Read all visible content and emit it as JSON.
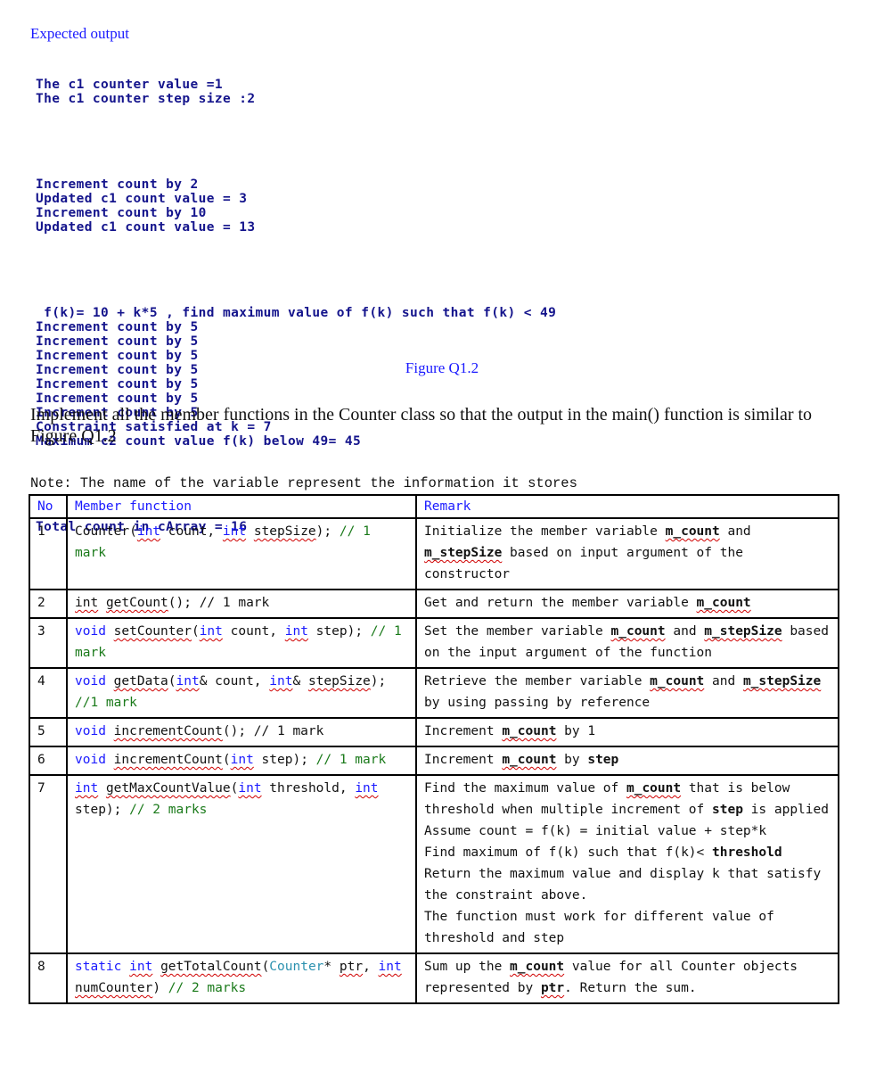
{
  "expected_label": "Expected output",
  "console": {
    "block1": [
      "The c1 counter value =1",
      "The c1 counter step size :2"
    ],
    "block2": [
      "Increment count by 2",
      "Updated c1 count value = 3",
      "Increment count by 10",
      "Updated c1 count value = 13"
    ],
    "block3": [
      " f(k)= 10 + k*5 , find maximum value of f(k) such that f(k) < 49",
      "Increment count by 5",
      "Increment count by 5",
      "Increment count by 5",
      "Increment count by 5",
      "Increment count by 5",
      "Increment count by 5",
      "Increment count by 5",
      "Constraint satisfied at k = 7",
      "Maximum c2 count value f(k) below 49= 45"
    ],
    "block4": [
      "Total count in cArray = 16"
    ]
  },
  "figure_caption": "Figure Q1.2",
  "instruction": "Implement all the member functions in the Counter class so that the output in the main() function is similar to Figure Q1.2",
  "note": "Note: The name of the variable represent the information it stores",
  "table": {
    "headers": {
      "no": "No",
      "function": "Member function",
      "remark": "Remark"
    },
    "rows": [
      {
        "no": "1",
        "function": [
          {
            "t": "Counter(",
            "c": ""
          },
          {
            "t": "int",
            "c": "kw sq"
          },
          {
            "t": " count, ",
            "c": ""
          },
          {
            "t": "int",
            "c": "kw sq"
          },
          {
            "t": " ",
            "c": ""
          },
          {
            "t": "stepSize",
            "c": "sq"
          },
          {
            "t": "); ",
            "c": ""
          },
          {
            "t": "// 1 mark",
            "c": "cm"
          }
        ],
        "remark": [
          [
            {
              "t": "Initialize the member variable ",
              "c": ""
            },
            {
              "t": "m_count",
              "c": "b sq"
            },
            {
              "t": " and ",
              "c": ""
            },
            {
              "t": "m_stepSize",
              "c": "b sq"
            },
            {
              "t": " based on input argument of the constructor",
              "c": ""
            }
          ]
        ]
      },
      {
        "no": "2",
        "function": [
          {
            "t": "int",
            "c": "sq"
          },
          {
            "t": " ",
            "c": ""
          },
          {
            "t": "getCount",
            "c": "sq"
          },
          {
            "t": "(); // 1 mark",
            "c": ""
          }
        ],
        "remark": [
          [
            {
              "t": "Get and return the member variable ",
              "c": ""
            },
            {
              "t": "m_count",
              "c": "b sq"
            }
          ]
        ]
      },
      {
        "no": "3",
        "function": [
          {
            "t": "void",
            "c": "kw"
          },
          {
            "t": " ",
            "c": ""
          },
          {
            "t": "setCounter",
            "c": "sq"
          },
          {
            "t": "(",
            "c": ""
          },
          {
            "t": "int",
            "c": "kw sq"
          },
          {
            "t": " count, ",
            "c": ""
          },
          {
            "t": "int",
            "c": "kw sq"
          },
          {
            "t": " step); ",
            "c": ""
          },
          {
            "t": "// 1 mark",
            "c": "cm"
          }
        ],
        "remark": [
          [
            {
              "t": "Set the member variable ",
              "c": ""
            },
            {
              "t": "m_count",
              "c": "b sq"
            },
            {
              "t": " and ",
              "c": ""
            },
            {
              "t": "m_stepSize",
              "c": "b sq"
            },
            {
              "t": " based on the input argument of the function",
              "c": ""
            }
          ]
        ]
      },
      {
        "no": "4",
        "function": [
          {
            "t": "void",
            "c": "kw"
          },
          {
            "t": " ",
            "c": ""
          },
          {
            "t": "getData",
            "c": "sq"
          },
          {
            "t": "(",
            "c": ""
          },
          {
            "t": "int",
            "c": "kw sq"
          },
          {
            "t": "& count, ",
            "c": ""
          },
          {
            "t": "int",
            "c": "kw sq"
          },
          {
            "t": "& ",
            "c": ""
          },
          {
            "t": "stepSize",
            "c": "sq"
          },
          {
            "t": "); ",
            "c": ""
          },
          {
            "t": "//1 mark",
            "c": "cm"
          }
        ],
        "remark": [
          [
            {
              "t": "Retrieve the member variable ",
              "c": ""
            },
            {
              "t": "m_count",
              "c": "b sq"
            },
            {
              "t": " and ",
              "c": ""
            },
            {
              "t": "m_stepSize",
              "c": "b sq"
            },
            {
              "t": " by using passing by reference",
              "c": ""
            }
          ]
        ]
      },
      {
        "no": "5",
        "function": [
          {
            "t": "void",
            "c": "kw"
          },
          {
            "t": " ",
            "c": ""
          },
          {
            "t": "incrementCount",
            "c": "sq"
          },
          {
            "t": "(); // 1 mark",
            "c": ""
          }
        ],
        "remark": [
          [
            {
              "t": "Increment ",
              "c": ""
            },
            {
              "t": "m_count",
              "c": "b sq"
            },
            {
              "t": " by 1",
              "c": ""
            }
          ]
        ]
      },
      {
        "no": "6",
        "function": [
          {
            "t": "void",
            "c": "kw"
          },
          {
            "t": " ",
            "c": ""
          },
          {
            "t": "incrementCount",
            "c": "sq"
          },
          {
            "t": "(",
            "c": ""
          },
          {
            "t": "int",
            "c": "kw sq"
          },
          {
            "t": " step); ",
            "c": ""
          },
          {
            "t": "// 1 mark",
            "c": "cm"
          }
        ],
        "remark": [
          [
            {
              "t": "Increment ",
              "c": ""
            },
            {
              "t": "m_count",
              "c": "b sq"
            },
            {
              "t": " by ",
              "c": ""
            },
            {
              "t": "step",
              "c": "b"
            }
          ]
        ]
      },
      {
        "no": "7",
        "function": [
          {
            "t": "int",
            "c": "kw sq"
          },
          {
            "t": " ",
            "c": ""
          },
          {
            "t": "getMaxCountValue",
            "c": "sq"
          },
          {
            "t": "(",
            "c": ""
          },
          {
            "t": "int",
            "c": "kw sq"
          },
          {
            "t": " threshold, ",
            "c": ""
          },
          {
            "t": "int",
            "c": "kw sq"
          },
          {
            "t": " step); ",
            "c": ""
          },
          {
            "t": "// 2 marks",
            "c": "cm"
          }
        ],
        "remark": [
          [
            {
              "t": "Find the maximum value of ",
              "c": ""
            },
            {
              "t": "m_count",
              "c": "b sq"
            },
            {
              "t": " that is below threshold when multiple increment of ",
              "c": ""
            },
            {
              "t": "step",
              "c": "b"
            },
            {
              "t": " is applied",
              "c": ""
            }
          ],
          [
            {
              "t": "Assume count = f(k) = initial value + step*k",
              "c": ""
            }
          ],
          [
            {
              "t": "Find maximum of f(k) such that f(k)< ",
              "c": ""
            },
            {
              "t": "threshold",
              "c": "b"
            }
          ],
          [
            {
              "t": "Return the maximum value and display k that satisfy the constraint above.",
              "c": ""
            }
          ],
          [
            {
              "t": "The function must work for different value of threshold and step",
              "c": ""
            }
          ]
        ]
      },
      {
        "no": "8",
        "function": [
          {
            "t": "static",
            "c": "kw"
          },
          {
            "t": " ",
            "c": ""
          },
          {
            "t": "int",
            "c": "kw sq"
          },
          {
            "t": " ",
            "c": ""
          },
          {
            "t": "getTotalCount",
            "c": "sq"
          },
          {
            "t": "(",
            "c": ""
          },
          {
            "t": "Counter",
            "c": "ty"
          },
          {
            "t": "* ",
            "c": ""
          },
          {
            "t": "ptr",
            "c": "sq"
          },
          {
            "t": ", ",
            "c": ""
          },
          {
            "t": "int",
            "c": "kw sq"
          },
          {
            "t": " ",
            "c": ""
          },
          {
            "t": "numCounter",
            "c": "sq"
          },
          {
            "t": ") ",
            "c": ""
          },
          {
            "t": "// 2 marks",
            "c": "cm"
          }
        ],
        "remark": [
          [
            {
              "t": "Sum up the ",
              "c": ""
            },
            {
              "t": "m_count",
              "c": "b sq"
            },
            {
              "t": " value for all Counter objects represented by ",
              "c": ""
            },
            {
              "t": "ptr",
              "c": "b sq"
            },
            {
              "t": ". Return the sum.",
              "c": ""
            }
          ]
        ]
      }
    ]
  }
}
